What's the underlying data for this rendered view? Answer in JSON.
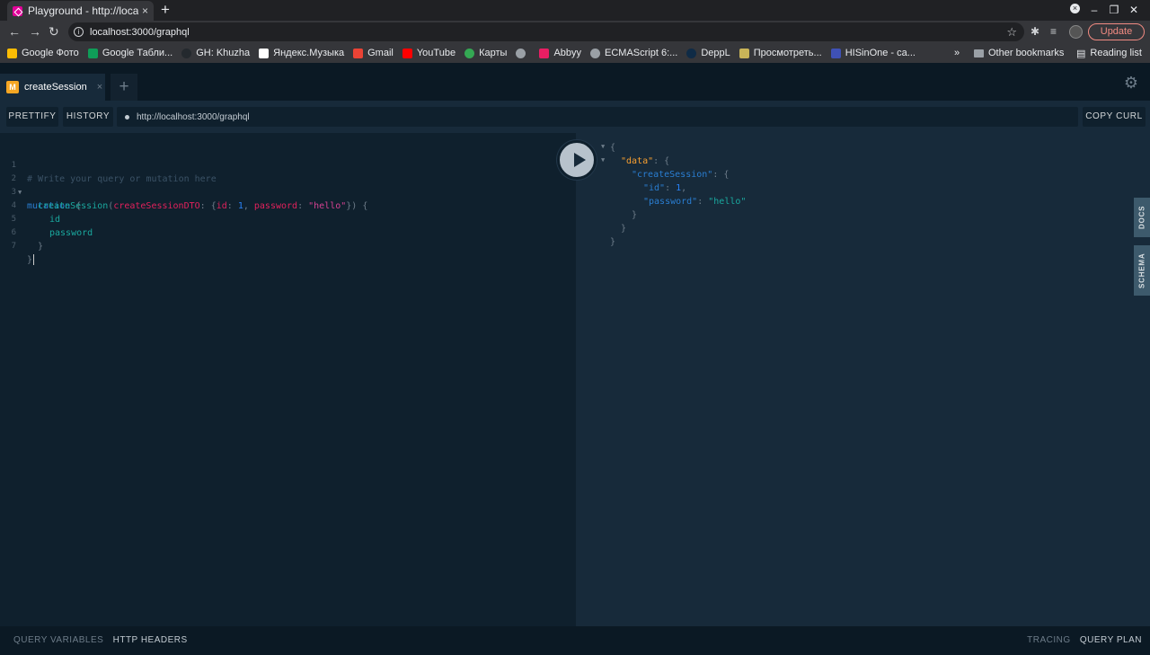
{
  "browser": {
    "tab_title": "Playground - http://localh",
    "tab_close": "×",
    "new_tab": "+",
    "url": "localhost:3000/graphql",
    "update_label": "Update",
    "bookmarks": [
      {
        "label": "Google Фото",
        "color": "#fbbc04"
      },
      {
        "label": "Google Табли...",
        "color": "#0f9d58"
      },
      {
        "label": "GH: Khuzha",
        "color": "#24292e"
      },
      {
        "label": "Яндекс.Музыка",
        "color": "#ffffff"
      },
      {
        "label": "Gmail",
        "color": "#ea4335"
      },
      {
        "label": "YouTube",
        "color": "#ff0000"
      },
      {
        "label": "Карты",
        "color": "#34a853"
      },
      {
        "label": "",
        "color": "#9aa0a6"
      },
      {
        "label": "Abbyy",
        "color": "#e91e63"
      },
      {
        "label": "ECMAScript 6:...",
        "color": "#9aa0a6"
      },
      {
        "label": "DeppL",
        "color": "#0f2b46"
      },
      {
        "label": "Просмотреть...",
        "color": "#c9b458"
      },
      {
        "label": "HISinOne - ca...",
        "color": "#3f51b5"
      }
    ],
    "bookmarks_more": "»",
    "other_bookmarks": "Other bookmarks",
    "reading_list": "Reading list"
  },
  "playground": {
    "tab_badge": "M",
    "tab_label": "createSession",
    "tab_close": "×",
    "add_tab": "+",
    "prettify": "PRETTIFY",
    "history": "HISTORY",
    "endpoint": "http://localhost:3000/graphql",
    "copy_curl": "COPY CURL",
    "docs": "DOCS",
    "schema": "SCHEMA",
    "query_variables": "QUERY VARIABLES",
    "http_headers": "HTTP HEADERS",
    "tracing": "TRACING",
    "query_plan": "QUERY PLAN"
  },
  "editor": {
    "line_numbers": [
      "1",
      "2",
      "3",
      "4",
      "5",
      "6",
      "7"
    ],
    "comment": "# Write your query or mutation here",
    "keyword": "mutation",
    "open_brace": "{",
    "field": "createSession",
    "paren_open": "(",
    "arg_name": "createSessionDTO",
    "colon": ": ",
    "obj_open": "{",
    "id_key": "id",
    "id_value": "1",
    "comma": ", ",
    "pw_key": "password",
    "pw_value": "\"hello\"",
    "args_close": "}) {",
    "sub_id": "id",
    "sub_password": "password",
    "inner_close": "}",
    "outer_close": "}"
  },
  "result": {
    "open": "{",
    "data_key": "\"data\"",
    "cs_key": "\"createSession\"",
    "id_key": "\"id\"",
    "id_value": "1",
    "pw_key": "\"password\"",
    "pw_value": "\"hello\"",
    "colon_brace": ": {",
    "colon": ": ",
    "comma": ",",
    "close": "}"
  }
}
